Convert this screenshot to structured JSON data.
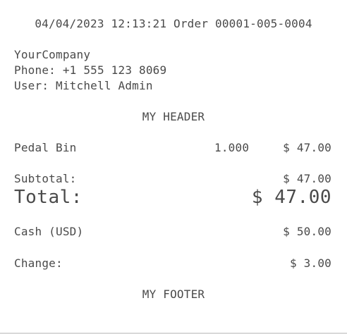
{
  "receipt": {
    "header_line": "04/04/2023 12:13:21 Order 00001-005-0004",
    "company": "YourCompany",
    "phone": "Phone: +1 555 123 8069",
    "user": "User: Mitchell Admin",
    "custom_header": "MY HEADER",
    "lines": [
      {
        "product": "Pedal Bin",
        "qty": "1.000",
        "price": "$ 47.00"
      }
    ],
    "subtotal_label": "Subtotal:",
    "subtotal_value": "$ 47.00",
    "total_label": "Total:",
    "total_value": "$ 47.00",
    "payment_label": "Cash (USD)",
    "payment_value": "$ 50.00",
    "change_label": "Change:",
    "change_value": "$ 3.00",
    "custom_footer": "MY FOOTER"
  }
}
